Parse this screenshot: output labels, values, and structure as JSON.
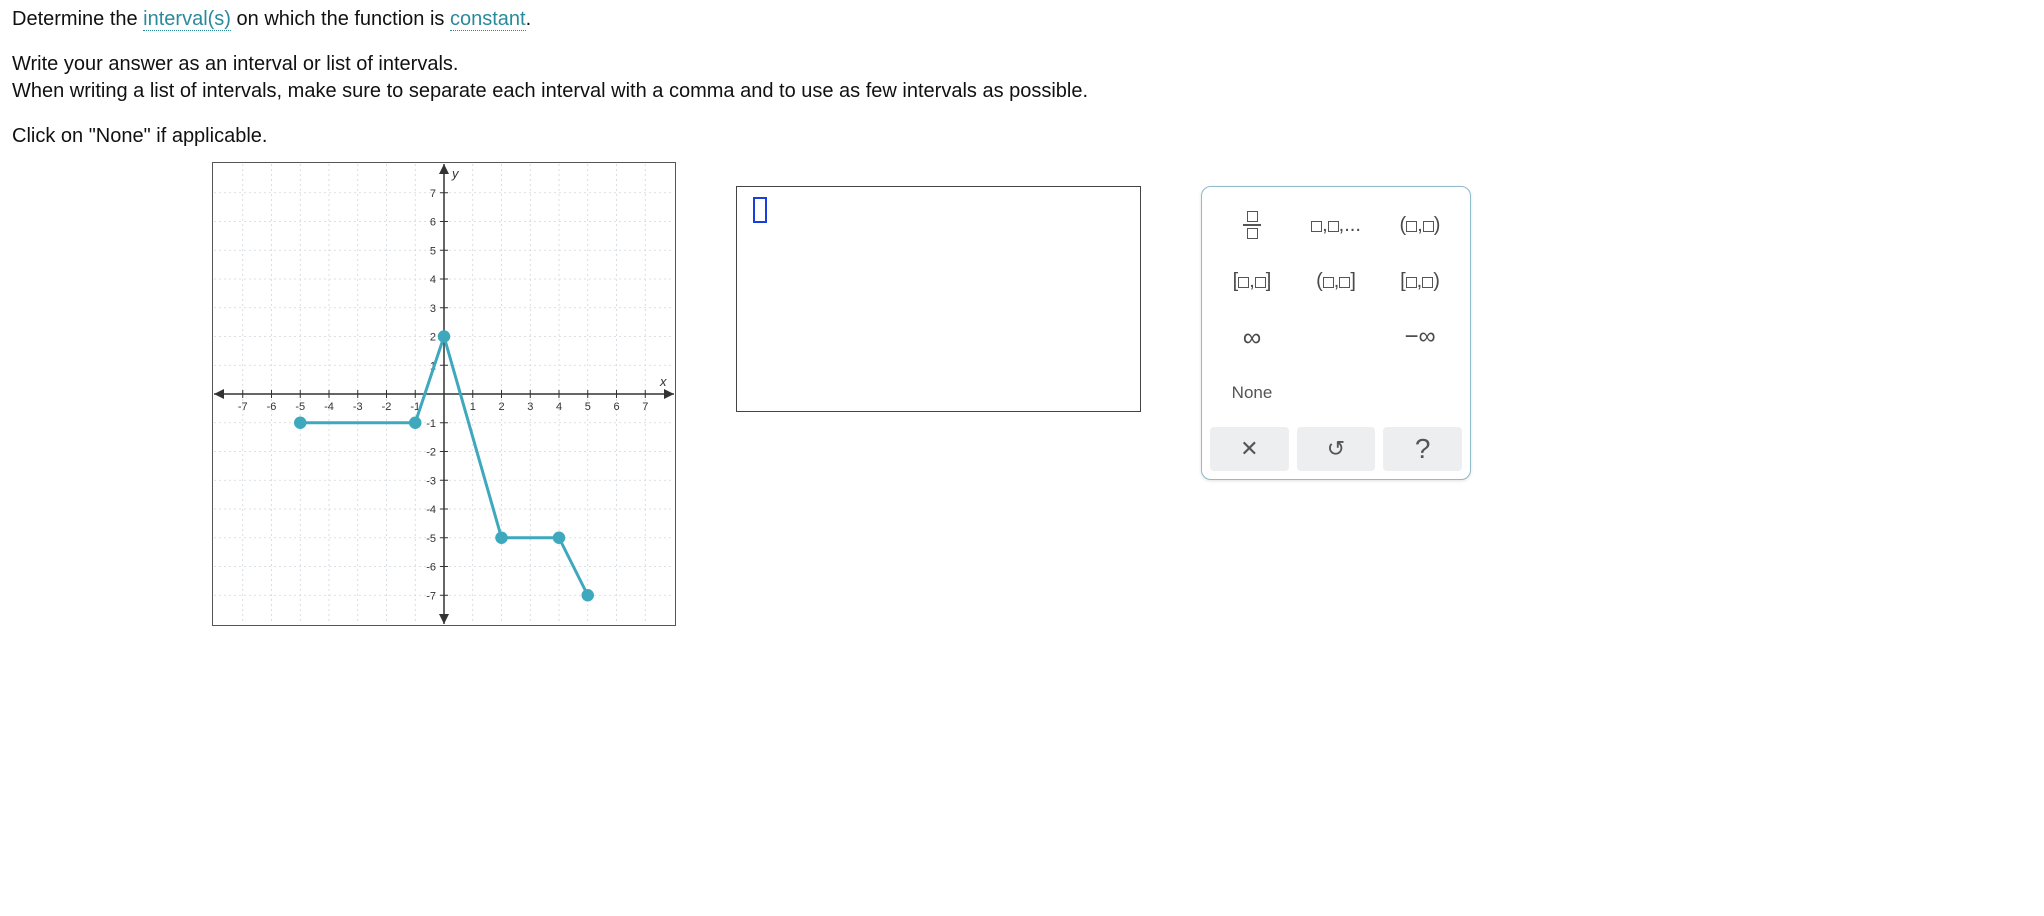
{
  "question": {
    "line1_pre": "Determine the ",
    "term1": "interval(s)",
    "line1_mid": " on which the function is ",
    "term2": "constant",
    "line1_post": ".",
    "line2": "Write your answer as an interval or list of intervals.",
    "line3": "When writing a list of intervals, make sure to separate each interval with a comma and to use as few intervals as possible.",
    "line4": "Click on \"None\" if applicable."
  },
  "answer": {
    "value": ""
  },
  "palette": {
    "list_label": ",",
    "list_ellipsis": ",...",
    "open_open_l": "(",
    "open_open_r": ")",
    "closed_closed_l": "[",
    "closed_closed_r": "]",
    "open_closed_l": "(",
    "open_closed_r": "]",
    "closed_open_l": "[",
    "closed_open_r": ")",
    "infinity": "∞",
    "neg_infinity": "−∞",
    "none": "None",
    "clear": "✕",
    "undo": "↺",
    "help": "?"
  },
  "chart_data": {
    "type": "line",
    "xlabel": "x",
    "ylabel": "y",
    "xlim": [
      -8,
      8
    ],
    "ylim": [
      -8,
      8
    ],
    "x_ticks": [
      -7,
      -6,
      -5,
      -4,
      -3,
      -2,
      -1,
      1,
      2,
      3,
      4,
      5,
      6,
      7
    ],
    "y_ticks": [
      -7,
      -6,
      -5,
      -4,
      -3,
      -2,
      -1,
      1,
      2,
      3,
      4,
      5,
      6,
      7
    ],
    "points": [
      {
        "x": -5,
        "y": -1,
        "closed": true
      },
      {
        "x": -1,
        "y": -1,
        "closed": true
      },
      {
        "x": 0,
        "y": 2,
        "closed": true
      },
      {
        "x": 2,
        "y": -5,
        "closed": true
      },
      {
        "x": 4,
        "y": -5,
        "closed": true
      },
      {
        "x": 5,
        "y": -7,
        "closed": true
      }
    ],
    "segments": [
      [
        [
          -5,
          -1
        ],
        [
          -1,
          -1
        ]
      ],
      [
        [
          -1,
          -1
        ],
        [
          0,
          2
        ]
      ],
      [
        [
          0,
          2
        ],
        [
          2,
          -5
        ]
      ],
      [
        [
          2,
          -5
        ],
        [
          4,
          -5
        ]
      ],
      [
        [
          4,
          -5
        ],
        [
          5,
          -7
        ]
      ]
    ]
  }
}
